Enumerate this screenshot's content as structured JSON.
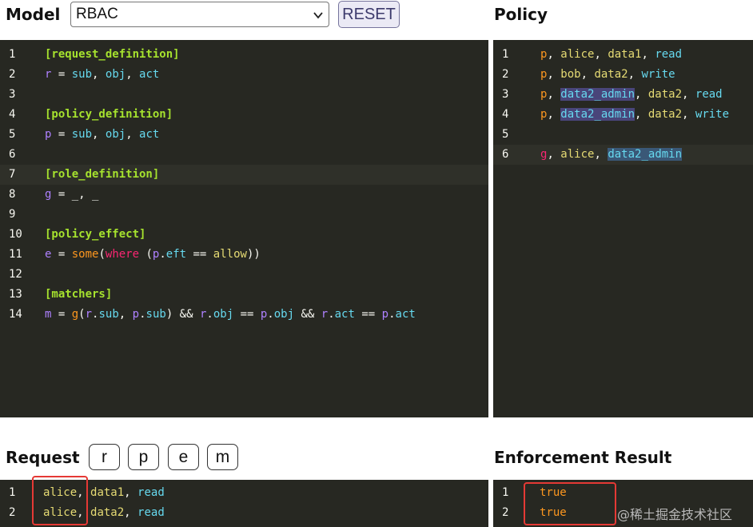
{
  "model": {
    "title": "Model",
    "selected": "RBAC",
    "reset_label": "RESET",
    "lines": [
      {
        "n": "1",
        "tokens": [
          {
            "t": "[request_definition]",
            "c": "h"
          }
        ]
      },
      {
        "n": "2",
        "tokens": [
          {
            "t": "r",
            "c": "v"
          },
          {
            "t": " = ",
            "c": "p"
          },
          {
            "t": "sub",
            "c": "k"
          },
          {
            "t": ", ",
            "c": "p"
          },
          {
            "t": "obj",
            "c": "k"
          },
          {
            "t": ", ",
            "c": "p"
          },
          {
            "t": "act",
            "c": "k"
          }
        ]
      },
      {
        "n": "3",
        "tokens": []
      },
      {
        "n": "4",
        "tokens": [
          {
            "t": "[policy_definition]",
            "c": "h"
          }
        ]
      },
      {
        "n": "5",
        "tokens": [
          {
            "t": "p",
            "c": "v"
          },
          {
            "t": " = ",
            "c": "p"
          },
          {
            "t": "sub",
            "c": "k"
          },
          {
            "t": ", ",
            "c": "p"
          },
          {
            "t": "obj",
            "c": "k"
          },
          {
            "t": ", ",
            "c": "p"
          },
          {
            "t": "act",
            "c": "k"
          }
        ]
      },
      {
        "n": "6",
        "tokens": []
      },
      {
        "n": "7",
        "tokens": [
          {
            "t": "[role_definition]",
            "c": "h"
          }
        ],
        "active": true
      },
      {
        "n": "8",
        "tokens": [
          {
            "t": "g",
            "c": "v"
          },
          {
            "t": " = ",
            "c": "p"
          },
          {
            "t": "_",
            "c": "p"
          },
          {
            "t": ", ",
            "c": "p"
          },
          {
            "t": "_",
            "c": "p"
          }
        ]
      },
      {
        "n": "9",
        "tokens": []
      },
      {
        "n": "10",
        "tokens": [
          {
            "t": "[policy_effect]",
            "c": "h"
          }
        ]
      },
      {
        "n": "11",
        "tokens": [
          {
            "t": "e",
            "c": "v"
          },
          {
            "t": " = ",
            "c": "p"
          },
          {
            "t": "some",
            "c": "o"
          },
          {
            "t": "(",
            "c": "p"
          },
          {
            "t": "where",
            "c": "r"
          },
          {
            "t": " (",
            "c": "p"
          },
          {
            "t": "p",
            "c": "v"
          },
          {
            "t": ".",
            "c": "p"
          },
          {
            "t": "eft",
            "c": "k"
          },
          {
            "t": " == ",
            "c": "p"
          },
          {
            "t": "allow",
            "c": "y"
          },
          {
            "t": "))",
            "c": "p"
          }
        ]
      },
      {
        "n": "12",
        "tokens": []
      },
      {
        "n": "13",
        "tokens": [
          {
            "t": "[matchers]",
            "c": "h"
          }
        ]
      },
      {
        "n": "14",
        "tokens": [
          {
            "t": "m",
            "c": "v"
          },
          {
            "t": " = ",
            "c": "p"
          },
          {
            "t": "g",
            "c": "o"
          },
          {
            "t": "(",
            "c": "p"
          },
          {
            "t": "r",
            "c": "v"
          },
          {
            "t": ".",
            "c": "p"
          },
          {
            "t": "sub",
            "c": "k"
          },
          {
            "t": ", ",
            "c": "p"
          },
          {
            "t": "p",
            "c": "v"
          },
          {
            "t": ".",
            "c": "p"
          },
          {
            "t": "sub",
            "c": "k"
          },
          {
            "t": ") && ",
            "c": "p"
          },
          {
            "t": "r",
            "c": "v"
          },
          {
            "t": ".",
            "c": "p"
          },
          {
            "t": "obj",
            "c": "k"
          },
          {
            "t": " == ",
            "c": "p"
          },
          {
            "t": "p",
            "c": "v"
          },
          {
            "t": ".",
            "c": "p"
          },
          {
            "t": "obj",
            "c": "k"
          },
          {
            "t": " && ",
            "c": "p"
          },
          {
            "t": "r",
            "c": "v"
          },
          {
            "t": ".",
            "c": "p"
          },
          {
            "t": "act",
            "c": "k"
          },
          {
            "t": " == ",
            "c": "p"
          },
          {
            "t": "p",
            "c": "v"
          },
          {
            "t": ".",
            "c": "p"
          },
          {
            "t": "act",
            "c": "k"
          }
        ]
      }
    ]
  },
  "policy": {
    "title": "Policy",
    "lines": [
      {
        "n": "1",
        "tokens": [
          {
            "t": "p",
            "c": "o"
          },
          {
            "t": ", ",
            "c": "p"
          },
          {
            "t": "alice",
            "c": "y"
          },
          {
            "t": ", ",
            "c": "p"
          },
          {
            "t": "data1",
            "c": "y"
          },
          {
            "t": ", ",
            "c": "p"
          },
          {
            "t": "read",
            "c": "k"
          }
        ]
      },
      {
        "n": "2",
        "tokens": [
          {
            "t": "p",
            "c": "o"
          },
          {
            "t": ", ",
            "c": "p"
          },
          {
            "t": "bob",
            "c": "y"
          },
          {
            "t": ", ",
            "c": "p"
          },
          {
            "t": "data2",
            "c": "y"
          },
          {
            "t": ", ",
            "c": "p"
          },
          {
            "t": "write",
            "c": "k"
          }
        ]
      },
      {
        "n": "3",
        "tokens": [
          {
            "t": "p",
            "c": "o"
          },
          {
            "t": ", ",
            "c": "p"
          },
          {
            "t": "data2_admin",
            "c": "k hl"
          },
          {
            "t": ", ",
            "c": "p"
          },
          {
            "t": "data2",
            "c": "y"
          },
          {
            "t": ", ",
            "c": "p"
          },
          {
            "t": "read",
            "c": "k"
          }
        ]
      },
      {
        "n": "4",
        "tokens": [
          {
            "t": "p",
            "c": "o"
          },
          {
            "t": ", ",
            "c": "p"
          },
          {
            "t": "data2_admin",
            "c": "k hl"
          },
          {
            "t": ", ",
            "c": "p"
          },
          {
            "t": "data2",
            "c": "y"
          },
          {
            "t": ", ",
            "c": "p"
          },
          {
            "t": "write",
            "c": "k"
          }
        ]
      },
      {
        "n": "5",
        "tokens": []
      },
      {
        "n": "6",
        "tokens": [
          {
            "t": "g",
            "c": "r"
          },
          {
            "t": ", ",
            "c": "p"
          },
          {
            "t": "alice",
            "c": "y"
          },
          {
            "t": ", ",
            "c": "p"
          },
          {
            "t": "data2_admin",
            "c": "k hl2"
          }
        ],
        "active": true
      }
    ]
  },
  "request": {
    "title": "Request",
    "tokens": [
      "r",
      "p",
      "e",
      "m"
    ],
    "lines": [
      {
        "n": "1",
        "tokens": [
          {
            "t": "alice",
            "c": "y"
          },
          {
            "t": ", ",
            "c": "p"
          },
          {
            "t": "data1",
            "c": "y"
          },
          {
            "t": ", ",
            "c": "p"
          },
          {
            "t": "read",
            "c": "k"
          }
        ]
      },
      {
        "n": "2",
        "tokens": [
          {
            "t": "alice",
            "c": "y"
          },
          {
            "t": ", ",
            "c": "p"
          },
          {
            "t": "data2",
            "c": "y"
          },
          {
            "t": ", ",
            "c": "p"
          },
          {
            "t": "read",
            "c": "k"
          }
        ]
      }
    ]
  },
  "result": {
    "title": "Enforcement Result",
    "lines": [
      {
        "n": "1",
        "tokens": [
          {
            "t": "true",
            "c": "o"
          }
        ]
      },
      {
        "n": "2",
        "tokens": [
          {
            "t": "true",
            "c": "o"
          }
        ]
      }
    ]
  },
  "watermark": "@稀土掘金技术社区"
}
